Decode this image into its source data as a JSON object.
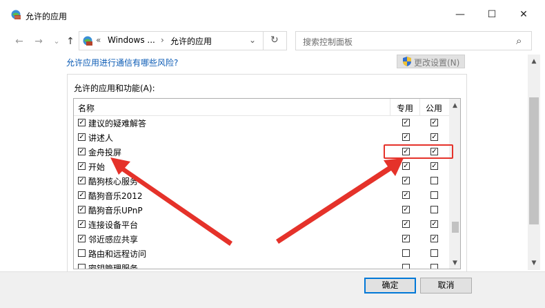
{
  "window": {
    "title": "允许的应用",
    "minimize_glyph": "—",
    "maximize_glyph": "☐",
    "close_glyph": "✕"
  },
  "nav": {
    "back_glyph": "←",
    "forward_glyph": "→",
    "dropdown_glyph": "⌄",
    "up_glyph": "↑"
  },
  "address": {
    "chevrons": "«",
    "segment1": "Windows ...",
    "arrow": "›",
    "segment2": "允许的应用",
    "dropdown_glyph": "⌄",
    "refresh_glyph": "↻"
  },
  "search": {
    "placeholder": "搜索控制面板",
    "icon_glyph": "⌕"
  },
  "panel": {
    "risk_link": "允许应用进行通信有哪些风险?",
    "change_settings": "更改设置(N)",
    "group_label": "允许的应用和功能(A):"
  },
  "list": {
    "header": {
      "name": "名称",
      "private": "专用",
      "public": "公用"
    },
    "rows": [
      {
        "name": "建议的疑难解答",
        "enabled": true,
        "private": true,
        "public": true
      },
      {
        "name": "讲述人",
        "enabled": true,
        "private": true,
        "public": true
      },
      {
        "name": "金舟投屏",
        "enabled": true,
        "private": true,
        "public": true
      },
      {
        "name": "开始",
        "enabled": true,
        "private": true,
        "public": true
      },
      {
        "name": "酷狗核心服务",
        "enabled": true,
        "private": true,
        "public": false
      },
      {
        "name": "酷狗音乐2012",
        "enabled": true,
        "private": true,
        "public": false
      },
      {
        "name": "酷狗音乐UPnP",
        "enabled": true,
        "private": true,
        "public": false
      },
      {
        "name": "连接设备平台",
        "enabled": true,
        "private": true,
        "public": true
      },
      {
        "name": "邻近感应共享",
        "enabled": true,
        "private": true,
        "public": true
      },
      {
        "name": "路由和远程访问",
        "enabled": false,
        "private": false,
        "public": false
      },
      {
        "name": "密钥管理服务",
        "enabled": false,
        "private": false,
        "public": false
      }
    ]
  },
  "buttons": {
    "ok": "确定",
    "cancel": "取消"
  },
  "colors": {
    "link": "#0b5bb5",
    "annotation": "#e5322a",
    "highlight_border": "#0078d7"
  }
}
